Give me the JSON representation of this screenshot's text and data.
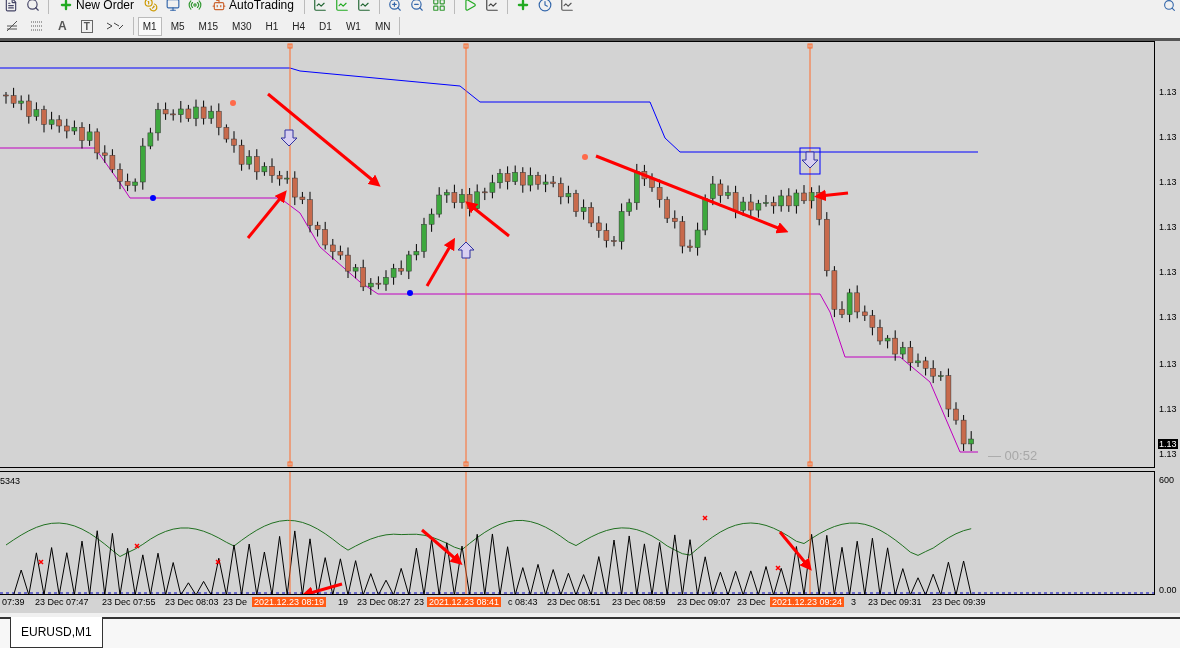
{
  "toolbar": {
    "buttons": [
      {
        "label": "New Order",
        "kind": "order"
      },
      {
        "label": "AutoTrading",
        "kind": "auto"
      }
    ]
  },
  "draw_tools": [
    {
      "kind": "fibo-e"
    },
    {
      "kind": "fibo-f"
    },
    {
      "kind": "text",
      "label": "A"
    },
    {
      "kind": "label",
      "label": "T"
    },
    {
      "kind": "arrows"
    }
  ],
  "timeframes": [
    {
      "label": "M1",
      "selected": true
    },
    {
      "label": "M5",
      "selected": false
    },
    {
      "label": "M15",
      "selected": false
    },
    {
      "label": "M30",
      "selected": false
    },
    {
      "label": "H1",
      "selected": false
    },
    {
      "label": "H4",
      "selected": false
    },
    {
      "label": "D1",
      "selected": false
    },
    {
      "label": "W1",
      "selected": false
    },
    {
      "label": "MN",
      "selected": false
    }
  ],
  "price_axis": [
    {
      "label": "1.13",
      "kind": "tick"
    },
    {
      "label": "1.13",
      "kind": "tick"
    },
    {
      "label": "1.13",
      "kind": "tick"
    },
    {
      "label": "1.13",
      "kind": "tick"
    },
    {
      "label": "1.13",
      "kind": "tick"
    },
    {
      "label": "1.13",
      "kind": "tick"
    },
    {
      "label": "1.13",
      "kind": "tick"
    },
    {
      "label": "1.13",
      "kind": "tick"
    },
    {
      "label": "1.13",
      "kind": "current"
    },
    {
      "label": "1.13",
      "kind": "tick"
    }
  ],
  "countdown": "— 00:52",
  "indicator": {
    "value_label": "5343",
    "axis": [
      "600",
      "0.00"
    ]
  },
  "time_axis": [
    {
      "label": "07:39",
      "kind": "tick"
    },
    {
      "label": "23 Dec 07:47",
      "kind": "tick"
    },
    {
      "label": "23 Dec 07:55",
      "kind": "tick"
    },
    {
      "label": "23 Dec 08:03",
      "kind": "tick"
    },
    {
      "label": "23 De",
      "kind": "tick"
    },
    {
      "label": "2021.12.23 08:19",
      "kind": "marker"
    },
    {
      "label": "19",
      "kind": "tick"
    },
    {
      "label": "23 Dec 08:27",
      "kind": "tick"
    },
    {
      "label": "23",
      "kind": "tick"
    },
    {
      "label": "2021.12.23 08:41",
      "kind": "marker"
    },
    {
      "label": "c 08:43",
      "kind": "tick"
    },
    {
      "label": "23 Dec 08:51",
      "kind": "tick"
    },
    {
      "label": "23 Dec 08:59",
      "kind": "tick"
    },
    {
      "label": "23 Dec 09:07",
      "kind": "tick"
    },
    {
      "label": "23 Dec",
      "kind": "tick"
    },
    {
      "label": "2021.12.23 09:24",
      "kind": "marker"
    },
    {
      "label": "3",
      "kind": "tick"
    },
    {
      "label": "23 Dec 09:31",
      "kind": "tick"
    },
    {
      "label": "23 Dec 09:39",
      "kind": "tick"
    }
  ],
  "tabs": [
    {
      "label": "EURUSD,M1",
      "selected": true
    }
  ]
}
